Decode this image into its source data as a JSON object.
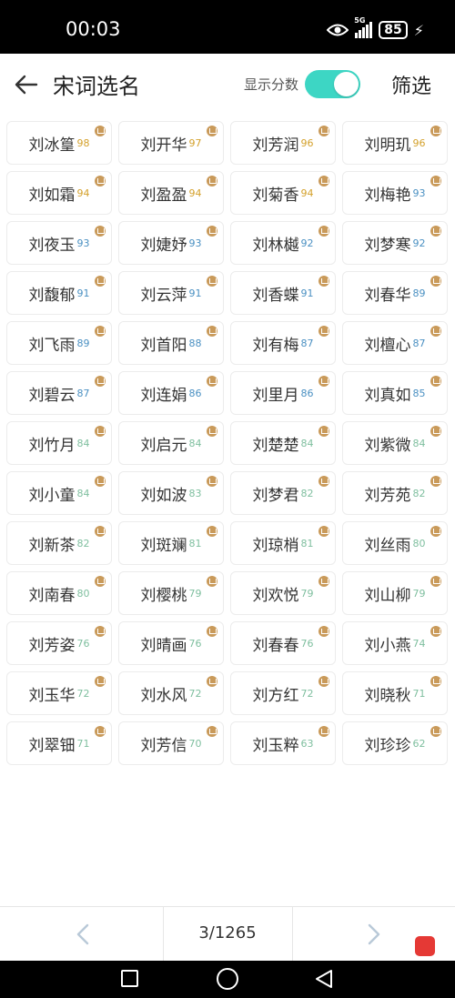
{
  "status": {
    "time": "00:03",
    "network": "5G",
    "battery": "85"
  },
  "header": {
    "title": "宋词选名",
    "score_toggle_label": "显示分数",
    "filter_label": "筛选"
  },
  "colors": {
    "accent": "#3dd6c4",
    "score_high": "#d4a12c",
    "score_mid": "#4a90c2",
    "score_low": "#7fbf9f",
    "crown": "#c99a5a"
  },
  "names": [
    {
      "name": "刘冰篁",
      "score": "98",
      "tier": "high"
    },
    {
      "name": "刘开华",
      "score": "97",
      "tier": "high"
    },
    {
      "name": "刘芳润",
      "score": "96",
      "tier": "high"
    },
    {
      "name": "刘明玑",
      "score": "96",
      "tier": "high"
    },
    {
      "name": "刘如霜",
      "score": "94",
      "tier": "high"
    },
    {
      "name": "刘盈盈",
      "score": "94",
      "tier": "high"
    },
    {
      "name": "刘菊香",
      "score": "94",
      "tier": "high"
    },
    {
      "name": "刘梅艳",
      "score": "93",
      "tier": "mid"
    },
    {
      "name": "刘夜玉",
      "score": "93",
      "tier": "mid"
    },
    {
      "name": "刘婕妤",
      "score": "93",
      "tier": "mid"
    },
    {
      "name": "刘林樾",
      "score": "92",
      "tier": "mid"
    },
    {
      "name": "刘梦寒",
      "score": "92",
      "tier": "mid"
    },
    {
      "name": "刘馥郁",
      "score": "91",
      "tier": "mid"
    },
    {
      "name": "刘云萍",
      "score": "91",
      "tier": "mid"
    },
    {
      "name": "刘香蝶",
      "score": "91",
      "tier": "mid"
    },
    {
      "name": "刘春华",
      "score": "89",
      "tier": "mid"
    },
    {
      "name": "刘飞雨",
      "score": "89",
      "tier": "mid"
    },
    {
      "name": "刘首阳",
      "score": "88",
      "tier": "mid"
    },
    {
      "name": "刘有梅",
      "score": "87",
      "tier": "mid"
    },
    {
      "name": "刘檀心",
      "score": "87",
      "tier": "mid"
    },
    {
      "name": "刘碧云",
      "score": "87",
      "tier": "mid"
    },
    {
      "name": "刘连娟",
      "score": "86",
      "tier": "mid"
    },
    {
      "name": "刘里月",
      "score": "86",
      "tier": "mid"
    },
    {
      "name": "刘真如",
      "score": "85",
      "tier": "mid"
    },
    {
      "name": "刘竹月",
      "score": "84",
      "tier": "low"
    },
    {
      "name": "刘启元",
      "score": "84",
      "tier": "low"
    },
    {
      "name": "刘楚楚",
      "score": "84",
      "tier": "low"
    },
    {
      "name": "刘紫微",
      "score": "84",
      "tier": "low"
    },
    {
      "name": "刘小童",
      "score": "84",
      "tier": "low"
    },
    {
      "name": "刘如波",
      "score": "83",
      "tier": "low"
    },
    {
      "name": "刘梦君",
      "score": "82",
      "tier": "low"
    },
    {
      "name": "刘芳苑",
      "score": "82",
      "tier": "low"
    },
    {
      "name": "刘新茶",
      "score": "82",
      "tier": "low"
    },
    {
      "name": "刘斑斓",
      "score": "81",
      "tier": "low"
    },
    {
      "name": "刘琼梢",
      "score": "81",
      "tier": "low"
    },
    {
      "name": "刘丝雨",
      "score": "80",
      "tier": "low"
    },
    {
      "name": "刘南春",
      "score": "80",
      "tier": "low"
    },
    {
      "name": "刘樱桃",
      "score": "79",
      "tier": "low"
    },
    {
      "name": "刘欢悦",
      "score": "79",
      "tier": "low"
    },
    {
      "name": "刘山柳",
      "score": "79",
      "tier": "low"
    },
    {
      "name": "刘芳姿",
      "score": "76",
      "tier": "low"
    },
    {
      "name": "刘晴画",
      "score": "76",
      "tier": "low"
    },
    {
      "name": "刘春春",
      "score": "76",
      "tier": "low"
    },
    {
      "name": "刘小燕",
      "score": "74",
      "tier": "low"
    },
    {
      "name": "刘玉华",
      "score": "72",
      "tier": "low"
    },
    {
      "name": "刘水风",
      "score": "72",
      "tier": "low"
    },
    {
      "name": "刘方红",
      "score": "72",
      "tier": "low"
    },
    {
      "name": "刘晓秋",
      "score": "71",
      "tier": "low"
    },
    {
      "name": "刘翠钿",
      "score": "71",
      "tier": "low"
    },
    {
      "name": "刘芳信",
      "score": "70",
      "tier": "low"
    },
    {
      "name": "刘玉粹",
      "score": "63",
      "tier": "low"
    },
    {
      "name": "刘珍珍",
      "score": "62",
      "tier": "low"
    }
  ],
  "pagination": {
    "indicator": "3/1265"
  }
}
